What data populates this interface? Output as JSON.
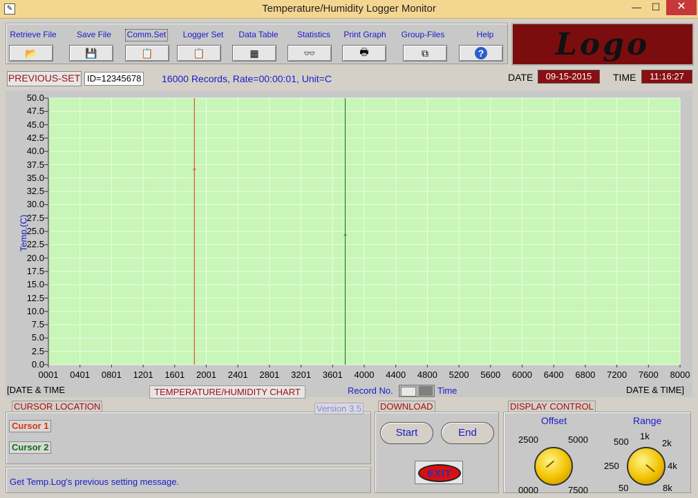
{
  "window": {
    "title": "Temperature/Humidity Logger Monitor",
    "minimize": "—",
    "maximize": "☐",
    "close": "✕"
  },
  "toolbar": [
    {
      "label": "Retrieve File",
      "icon": "📂"
    },
    {
      "label": "Save File",
      "icon": "💾"
    },
    {
      "label": "Comm.Set",
      "icon": "📋"
    },
    {
      "label": "Logger Set",
      "icon": "📋"
    },
    {
      "label": "Data Table",
      "icon": "▦"
    },
    {
      "label": "Statistics",
      "icon": "👓"
    },
    {
      "label": "Print Graph",
      "icon": "🖶"
    },
    {
      "label": "Group-Files",
      "icon": "⧉"
    },
    {
      "label": "Help",
      "icon": "?"
    }
  ],
  "logo": "Logo",
  "info": {
    "previous_set": "PREVIOUS-SET",
    "id": "ID=12345678",
    "records": "16000 Records, Rate=00:00:01, Unit=C",
    "date_label": "DATE",
    "date_value": "09-15-2015",
    "time_label": "TIME",
    "time_value": "11:16:27"
  },
  "chart": {
    "ylabel": "Temp.(C)",
    "left_caption": "[DATE & TIME",
    "right_caption": "DATE & TIME]",
    "chart_title": "TEMPERATURE/HUMIDITY CHART",
    "toggle_left": "Record No.",
    "toggle_right": "Time"
  },
  "chart_data": {
    "type": "line",
    "ylabel": "Temp.(C)",
    "ylim": [
      0,
      50
    ],
    "xlim": [
      1,
      8000
    ],
    "yticks": [
      "50.0",
      "47.5",
      "45.0",
      "42.5",
      "40.0",
      "37.5",
      "35.0",
      "32.5",
      "30.0",
      "27.5",
      "25.0",
      "22.5",
      "20.0",
      "17.5",
      "15.0",
      "12.5",
      "10.0",
      "7.5",
      "5.0",
      "2.5",
      "0.0"
    ],
    "xticks": [
      "0001",
      "0401",
      "0801",
      "1201",
      "1601",
      "2001",
      "2401",
      "2801",
      "3201",
      "3601",
      "4000",
      "4400",
      "4800",
      "5200",
      "5600",
      "6000",
      "6400",
      "6800",
      "7200",
      "7600",
      "8000"
    ],
    "grid": true,
    "cursors": [
      {
        "name": "Cursor 1",
        "x": 1850,
        "y": 36.5,
        "color": "#e03010"
      },
      {
        "name": "Cursor 2",
        "x": 3760,
        "y": 24.2,
        "color": "#107010"
      }
    ]
  },
  "cursor_location": {
    "title": "CURSOR LOCATION",
    "version": "Version 3.5",
    "cursor1": "Cursor 1",
    "cursor2": "Cursor 2"
  },
  "download": {
    "title": "DOWNLOAD",
    "start": "Start",
    "end": "End",
    "exit": "EXIT"
  },
  "display_control": {
    "title": "DISPLAY CONTROL",
    "offset_label": "Offset",
    "offset_ticks": [
      "2500",
      "5000",
      "0000",
      "7500"
    ],
    "range_label": "Range",
    "range_ticks": [
      "1k",
      "500",
      "2k",
      "250",
      "4k",
      "50",
      "8k"
    ]
  },
  "status": "Get Temp.Log's previous setting message."
}
